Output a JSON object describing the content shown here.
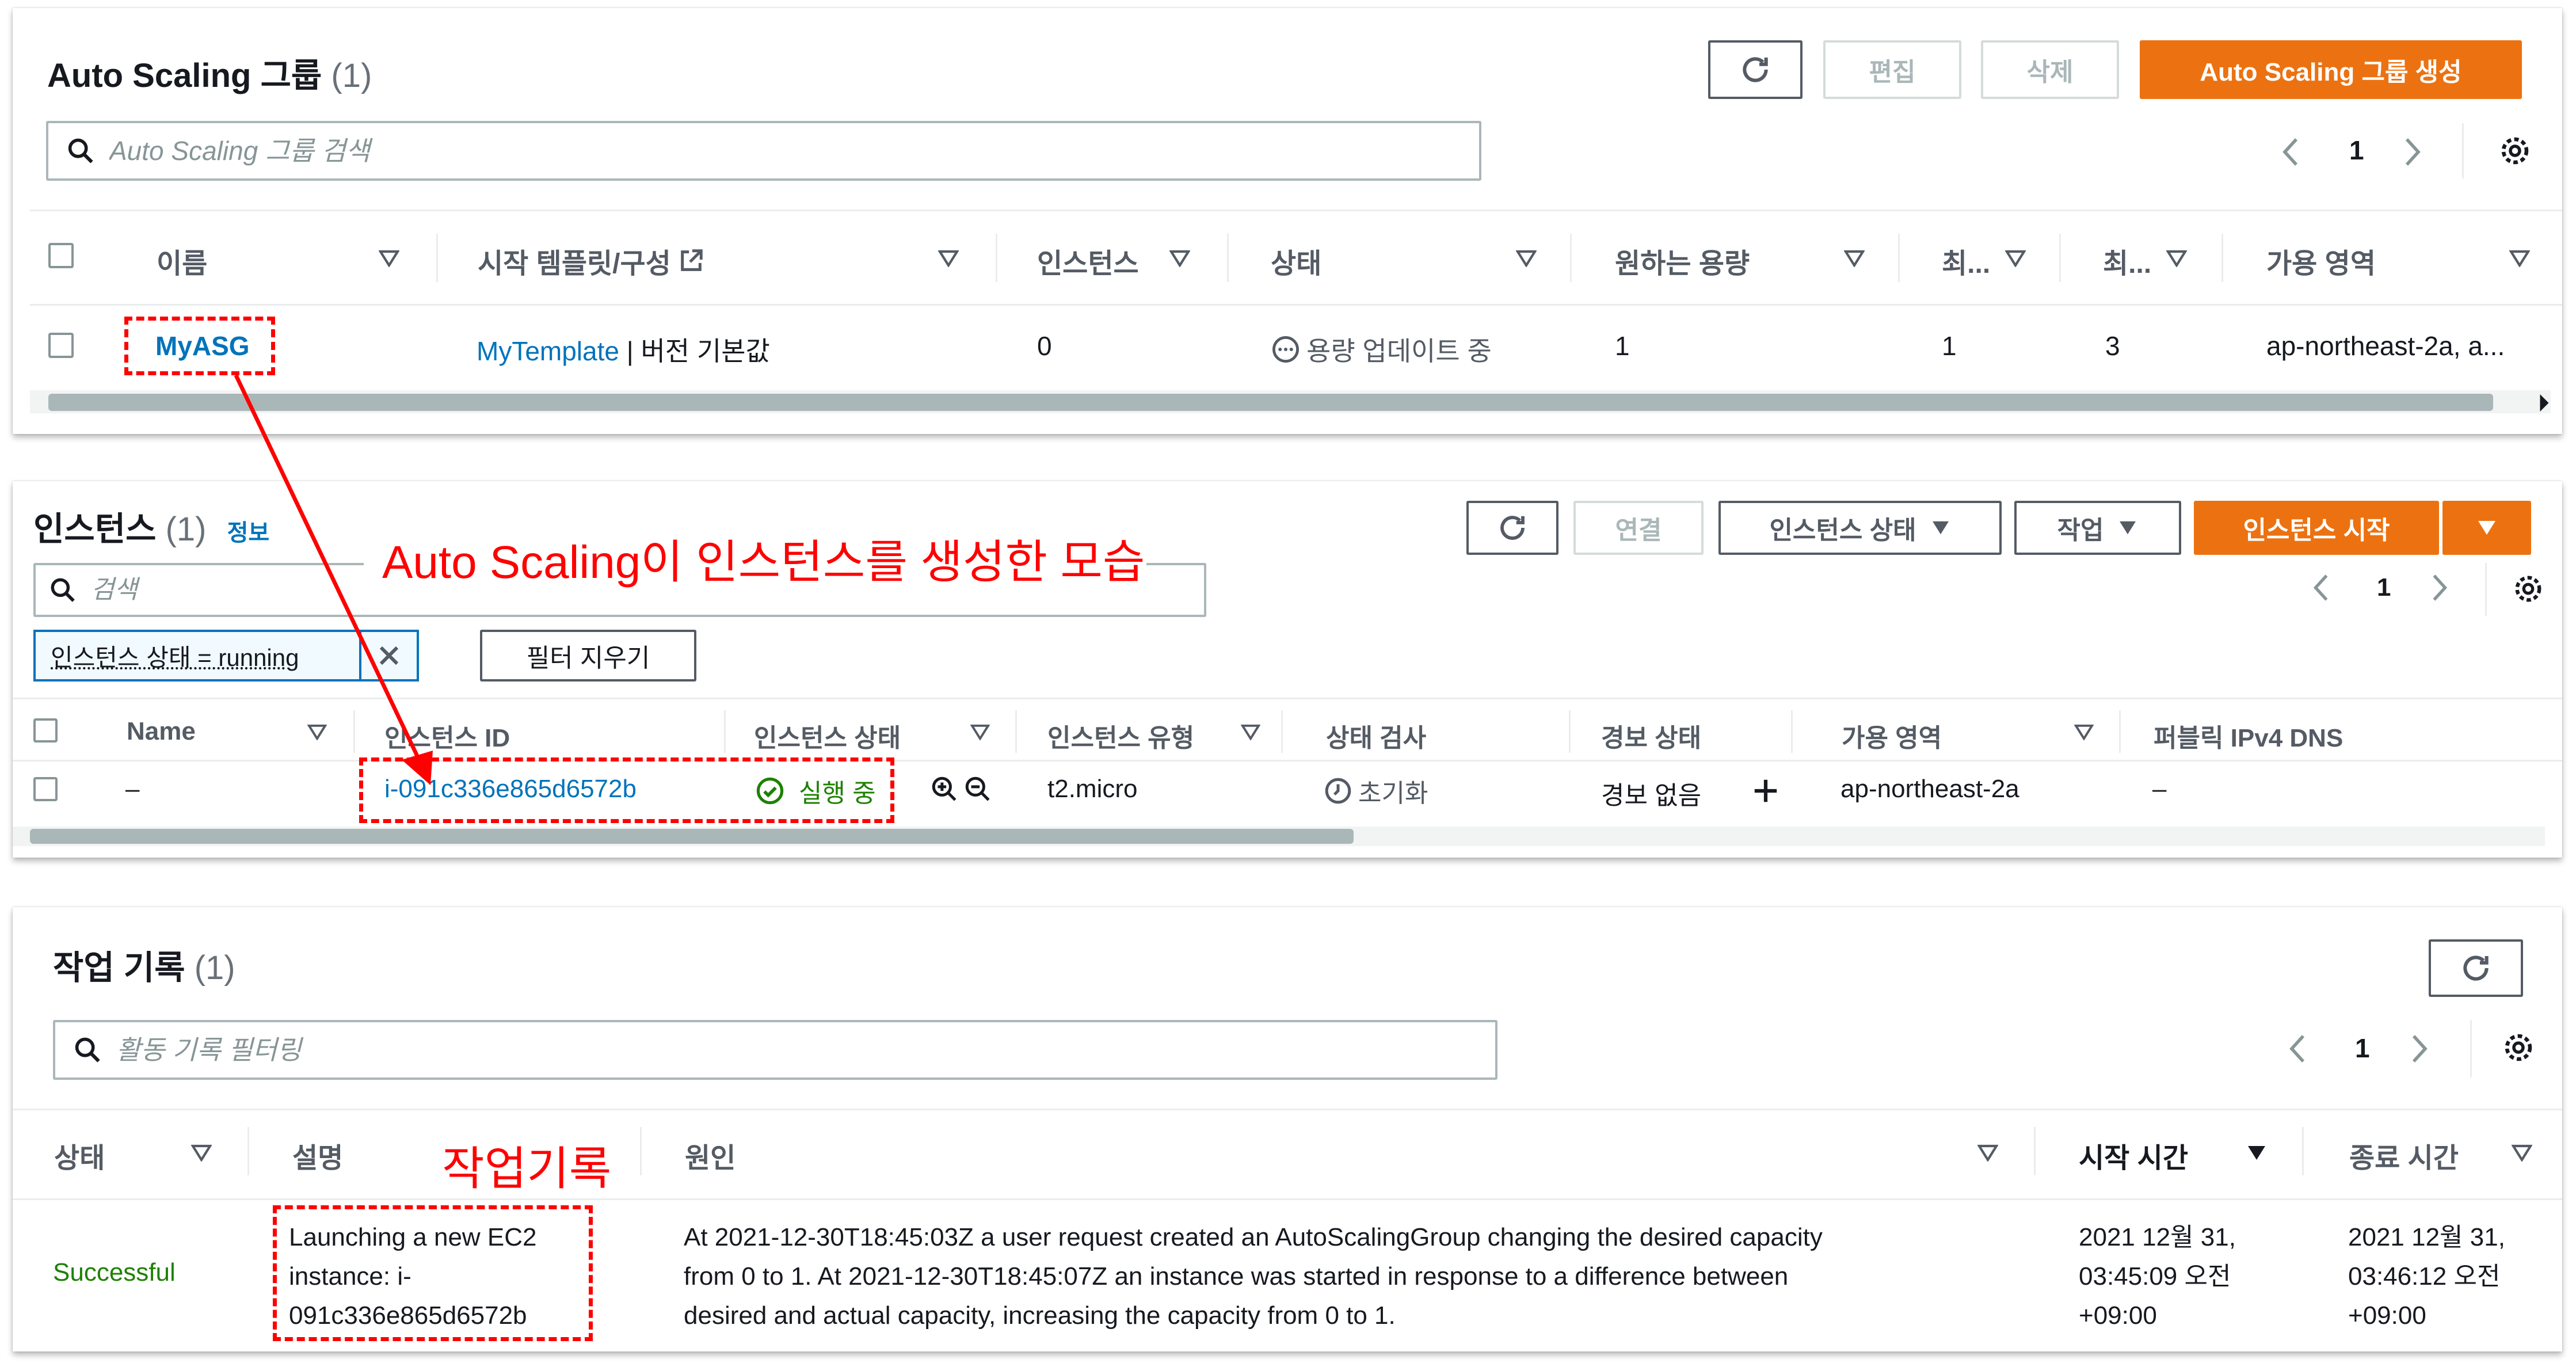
{
  "asg": {
    "title": "Auto Scaling 그룹",
    "count": "(1)",
    "buttons": {
      "edit": "편집",
      "delete": "삭제",
      "create": "Auto Scaling 그룹 생성"
    },
    "search_placeholder": "Auto Scaling 그룹 검색",
    "page": "1",
    "columns": [
      "이름",
      "시작 템플릿/구성",
      "인스턴스",
      "상태",
      "원하는 용량",
      "최...",
      "최...",
      "가용 영역"
    ],
    "row": {
      "name": "MyASG",
      "template_link": "MyTemplate",
      "template_suffix": " | 버전 기본값",
      "instances": "0",
      "status": "용량 업데이트 중",
      "desired": "1",
      "min": "1",
      "max": "3",
      "az": "ap-northeast-2a, a..."
    }
  },
  "instances": {
    "title": "인스턴스",
    "count": "(1)",
    "info_link": "정보",
    "buttons": {
      "connect": "연결",
      "state": "인스턴스 상태",
      "actions": "작업",
      "launch": "인스턴스 시작"
    },
    "search_placeholder": "검색",
    "filter_token": "인스턴스 상태 = running",
    "clear_filters": "필터 지우기",
    "page": "1",
    "columns": [
      "Name",
      "인스턴스 ID",
      "인스턴스 상태",
      "인스턴스 유형",
      "상태 검사",
      "경보 상태",
      "가용 영역",
      "퍼블릭 IPv4 DNS"
    ],
    "row": {
      "name": "–",
      "id": "i-091c336e865d6572b",
      "state": "실행 중",
      "type": "t2.micro",
      "check": "초기화",
      "alarm": "경보 없음",
      "az": "ap-northeast-2a",
      "dns": "–"
    }
  },
  "activity": {
    "title": "작업 기록",
    "count": "(1)",
    "search_placeholder": "활동 기록 필터링",
    "page": "1",
    "columns": [
      "상태",
      "설명",
      "원인",
      "시작 시간",
      "종료 시간"
    ],
    "row": {
      "status": "Successful",
      "description": [
        "Launching a new EC2",
        "instance: i-",
        "091c336e865d6572b"
      ],
      "cause": [
        "At 2021-12-30T18:45:03Z a user request created an AutoScalingGroup changing the desired capacity",
        "from 0 to 1. At 2021-12-30T18:45:07Z an instance was started in response to a difference between",
        "desired and actual capacity, increasing the capacity from 0 to 1."
      ],
      "start": [
        "2021 12월 31,",
        "03:45:09 오전",
        "+09:00"
      ],
      "end": [
        "2021 12월 31,",
        "03:46:12 오전",
        "+09:00"
      ]
    }
  },
  "annotations": {
    "launch_note": "Auto Scaling이 인스턴스를 생성한 모습",
    "history_note": "작업기록"
  },
  "colors": {
    "accent_orange": "#ec7211",
    "link_blue": "#0073bb",
    "success_green": "#1d8102",
    "annotation_red": "#ff0000"
  },
  "icons": [
    "refresh-icon",
    "search-icon",
    "settings-icon",
    "external-link-icon",
    "pending-icon",
    "check-circle-icon",
    "clock-icon",
    "zoom-in-icon",
    "zoom-out-icon",
    "plus-icon",
    "close-icon",
    "caret-down-icon",
    "chevron-left-icon",
    "chevron-right-icon"
  ]
}
